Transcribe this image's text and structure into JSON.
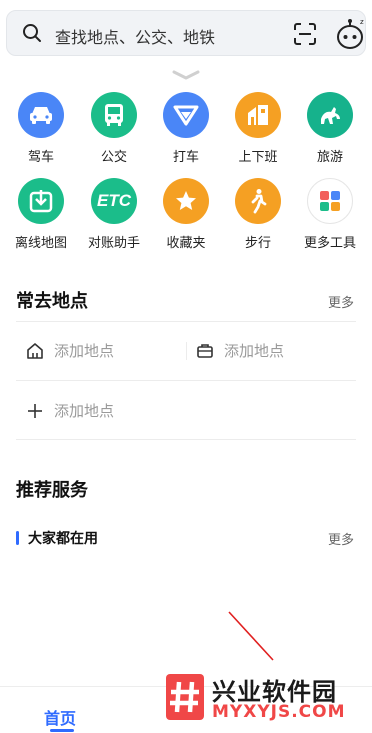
{
  "search": {
    "placeholder": "查找地点、公交、地铁"
  },
  "tools": [
    {
      "label": "驾车",
      "icon": "car-icon",
      "color": "#4a86f7"
    },
    {
      "label": "公交",
      "icon": "bus-icon",
      "color": "#1bbd8a"
    },
    {
      "label": "打车",
      "icon": "taxi-icon",
      "color": "#4a86f7"
    },
    {
      "label": "上下班",
      "icon": "commute-icon",
      "color": "#f5a023"
    },
    {
      "label": "旅游",
      "icon": "travel-icon",
      "color": "#16b28c"
    },
    {
      "label": "离线地图",
      "icon": "download-icon",
      "color": "#1bbd8a"
    },
    {
      "label": "对账助手",
      "icon": "etc-icon",
      "color": "#1bbd8a"
    },
    {
      "label": "收藏夹",
      "icon": "star-icon",
      "color": "#f5a023"
    },
    {
      "label": "步行",
      "icon": "walk-icon",
      "color": "#f5a023"
    },
    {
      "label": "更多工具",
      "icon": "more-tools-icon",
      "color": "#ffffff"
    }
  ],
  "frequent": {
    "title": "常去地点",
    "more": "更多",
    "home_label": "添加地点",
    "work_label": "添加地点",
    "add_label": "添加地点"
  },
  "recommend": {
    "title": "推荐服务",
    "subtitle": "大家都在用",
    "more": "更多"
  },
  "nav": {
    "home": "首页"
  },
  "watermark": {
    "title": "兴业软件园",
    "url": "MYXYJS.COM"
  }
}
